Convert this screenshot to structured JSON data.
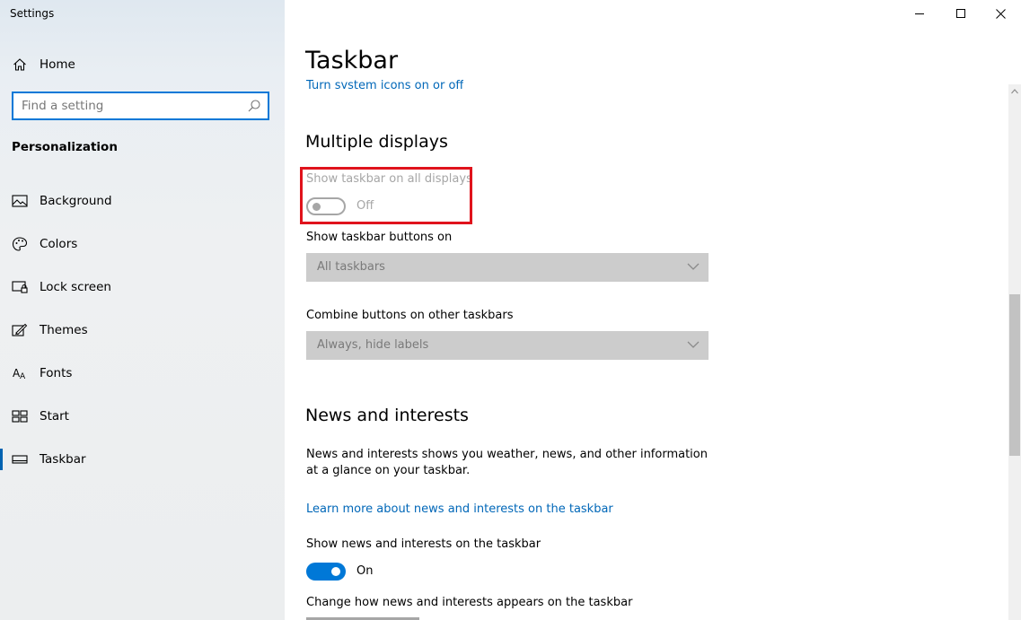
{
  "window": {
    "title": "Settings",
    "controls": [
      "minimize",
      "maximize",
      "close"
    ]
  },
  "sidebar": {
    "home_label": "Home",
    "search_placeholder": "Find a setting",
    "section_title": "Personalization",
    "items": [
      {
        "label": "Background",
        "icon": "picture-icon"
      },
      {
        "label": "Colors",
        "icon": "palette-icon"
      },
      {
        "label": "Lock screen",
        "icon": "lock-screen-icon"
      },
      {
        "label": "Themes",
        "icon": "brush-icon"
      },
      {
        "label": "Fonts",
        "icon": "fonts-icon"
      },
      {
        "label": "Start",
        "icon": "start-icon"
      },
      {
        "label": "Taskbar",
        "icon": "taskbar-icon",
        "active": true
      }
    ]
  },
  "main": {
    "page_title": "Taskbar",
    "cut_link": "Turn system icons on or off",
    "multiple_displays": {
      "heading": "Multiple displays",
      "show_all_label": "Show taskbar on all displays",
      "show_all_state": "Off",
      "buttons_on_label": "Show taskbar buttons on",
      "buttons_on_value": "All taskbars",
      "combine_label": "Combine buttons on other taskbars",
      "combine_value": "Always, hide labels"
    },
    "news": {
      "heading": "News and interests",
      "description": "News and interests shows you weather, news, and other information at a glance on your taskbar.",
      "learn_more": "Learn more about news and interests on the taskbar",
      "show_label": "Show news and interests on the taskbar",
      "show_state": "On",
      "change_label": "Change how news and interests appears on the taskbar"
    }
  },
  "colors": {
    "accent": "#0078d7",
    "highlight": "#e0131c",
    "disabled": "#a6a6a6",
    "link": "#0067b8"
  }
}
